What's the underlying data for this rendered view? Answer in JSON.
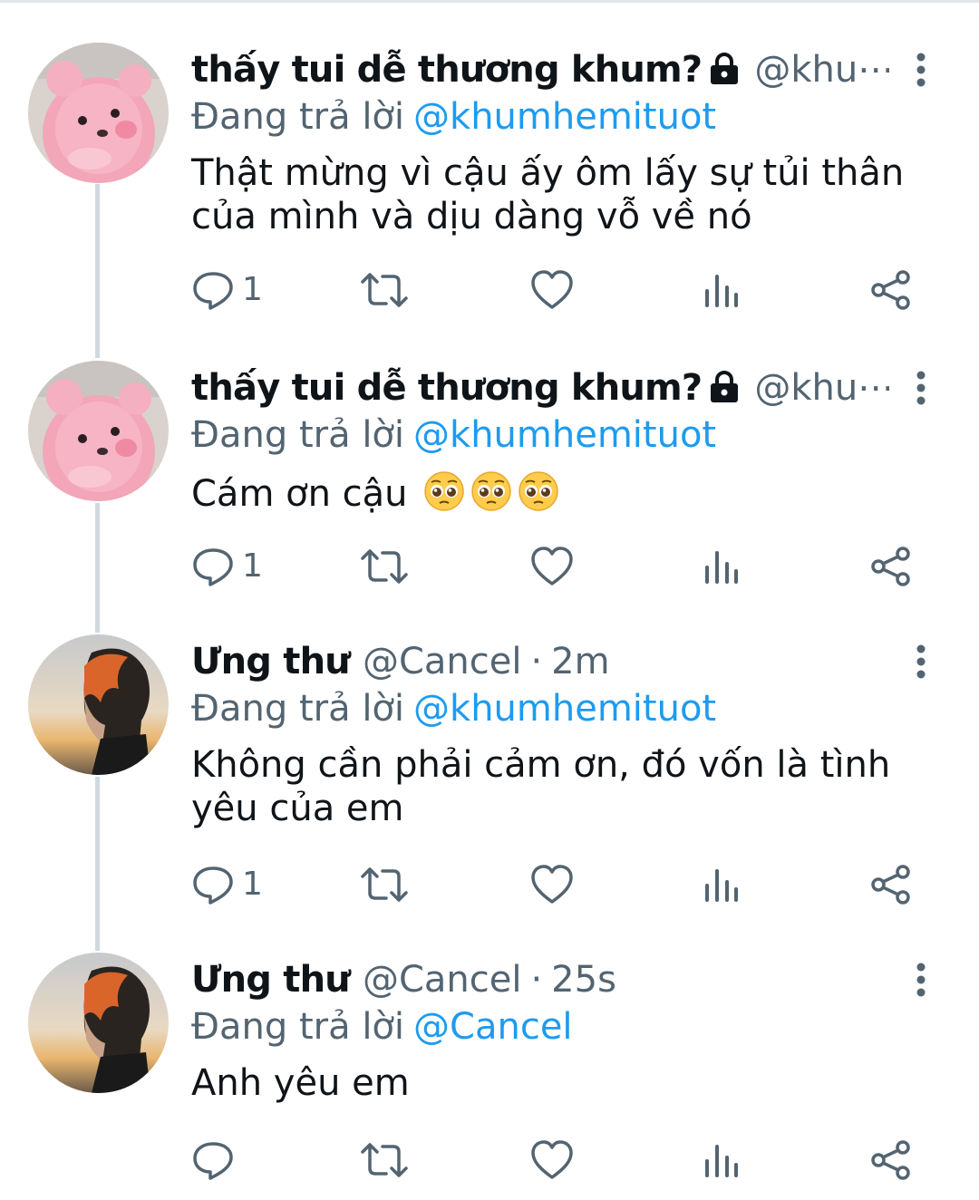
{
  "colors": {
    "accent": "#1d9bf0",
    "secondary_text": "#536471",
    "primary_text": "#0f1419",
    "thread_line": "#cfd9de"
  },
  "icons": {
    "lock": "lock-icon",
    "more": "more-vertical-icon",
    "reply": "reply-icon",
    "retweet": "retweet-icon",
    "like": "heart-icon",
    "views": "analytics-icon",
    "share": "share-icon",
    "emoji": "pleading-face-emoji"
  },
  "tweets": [
    {
      "name": "thấy tui dễ thương khum?",
      "protected": true,
      "handle": "@khu⋯",
      "time": "",
      "reply_prefix": "Đang trả lời",
      "reply_to": "@khumhemituot",
      "text_lines": [
        "Thật mừng vì cậu ấy ôm lấy sự tủi thân",
        "của mình và dịu dàng vỗ về nó"
      ],
      "reply_count": "1",
      "avatar": "pink-plush-avatar"
    },
    {
      "name": "thấy tui dễ thương khum?",
      "protected": true,
      "handle": "@khu⋯",
      "time": "",
      "reply_prefix": "Đang trả lời",
      "reply_to": "@khumhemituot",
      "text_lines": [
        "Cám ơn cậu"
      ],
      "emoji_count": 3,
      "reply_count": "1",
      "avatar": "pink-plush-avatar"
    },
    {
      "name": "Ưng thư",
      "protected": false,
      "handle": "@Cancel",
      "separator": "·",
      "time": "2m",
      "reply_prefix": "Đang trả lời",
      "reply_to": "@khumhemituot",
      "text_lines": [
        "Không cần phải cảm ơn, đó vốn là tình",
        "yêu của em"
      ],
      "reply_count": "1",
      "avatar": "sunset-portrait-avatar"
    },
    {
      "name": "Ưng thư",
      "protected": false,
      "handle": "@Cancel",
      "separator": "·",
      "time": "25s",
      "reply_prefix": "Đang trả lời",
      "reply_to": "@Cancel",
      "text_lines": [
        "Anh yêu em"
      ],
      "reply_count": "",
      "avatar": "sunset-portrait-avatar"
    }
  ]
}
